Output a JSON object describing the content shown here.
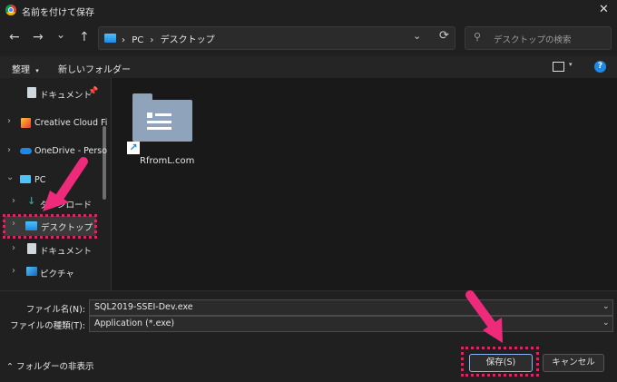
{
  "window": {
    "title": "名前を付けて保存",
    "close": "✕"
  },
  "nav": {
    "back": "←",
    "forward": "→",
    "recent": "⌄",
    "up": "↑",
    "breadcrumb_sep": "›",
    "path": [
      "PC",
      "デスクトップ"
    ],
    "refresh": "⟳",
    "search_placeholder": "デスクトップの検索"
  },
  "commands": {
    "organize": "整理",
    "new_folder": "新しいフォルダー"
  },
  "sidebar": {
    "items": [
      {
        "label": "ドキュメント",
        "icon": "document-icon",
        "pinned": true
      },
      {
        "label": "Creative Cloud Fi",
        "icon": "creative-cloud-folder-icon"
      },
      {
        "label": "OneDrive - Perso",
        "icon": "onedrive-cloud-icon"
      },
      {
        "label": "PC",
        "icon": "pc-monitor-icon"
      },
      {
        "label": "ダウンロード",
        "icon": "download-icon"
      },
      {
        "label": "デスクトップ",
        "icon": "desktop-folder-icon",
        "selected": true
      },
      {
        "label": "ドキュメント",
        "icon": "document-icon"
      },
      {
        "label": "ピクチャ",
        "icon": "pictures-icon"
      }
    ]
  },
  "files": [
    {
      "name": "RfromL.com",
      "type": "folder-shortcut"
    }
  ],
  "form": {
    "filename_label": "ファイル名(N):",
    "filename_value": "SQL2019-SSEI-Dev.exe",
    "filetype_label": "ファイルの種類(T):",
    "filetype_value": "Application (*.exe)"
  },
  "footer": {
    "hide_folders": "フォルダーの非表示",
    "save_button": "保存(S)",
    "cancel_button": "キャンセル"
  },
  "colors": {
    "accent": "#1e88e5",
    "highlight": "#e91e63",
    "arrow": "#ee2a7b",
    "background": "#191919"
  }
}
